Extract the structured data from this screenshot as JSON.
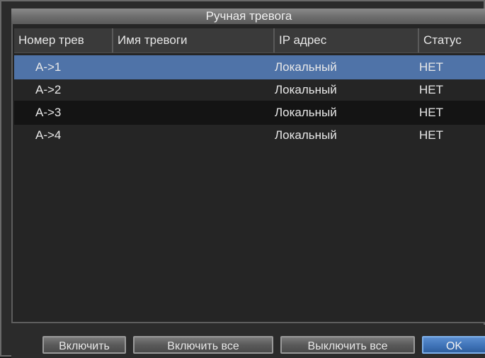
{
  "dialog": {
    "title": "Ручная тревога"
  },
  "table": {
    "columns": [
      {
        "label": "Номер трев"
      },
      {
        "label": "Имя тревоги"
      },
      {
        "label": "IP адрес"
      },
      {
        "label": "Статус"
      }
    ],
    "rows": [
      {
        "number": "A->1",
        "name": "",
        "ip": "Локальный",
        "status": "НЕТ",
        "state": "selected"
      },
      {
        "number": "A->2",
        "name": "",
        "ip": "Локальный",
        "status": "НЕТ",
        "state": "normal"
      },
      {
        "number": "A->3",
        "name": "",
        "ip": "Локальный",
        "status": "НЕТ",
        "state": "highlighted"
      },
      {
        "number": "A->4",
        "name": "",
        "ip": "Локальный",
        "status": "НЕТ",
        "state": "normal"
      }
    ]
  },
  "buttons": {
    "enable": "Включить",
    "enable_all": "Включить все",
    "disable_all": "Выключить все",
    "ok": "OK"
  },
  "colors": {
    "selected_row": "#4f73a8",
    "primary_button": "#3f73b8"
  }
}
